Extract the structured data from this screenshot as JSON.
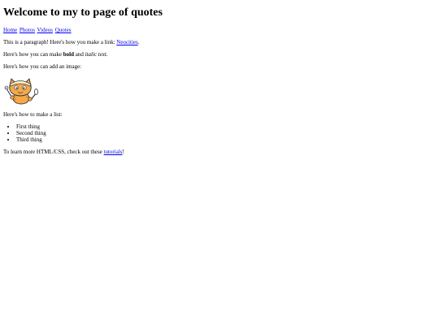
{
  "heading": "Welcome to my to page of quotes",
  "nav": {
    "home": "Home",
    "photos": "Photos",
    "videos": "Videos",
    "quotes": "Quotes"
  },
  "para1": {
    "text": "This is a paragraph! Here's how you make a link: ",
    "link": "Neocities",
    "end": "."
  },
  "para2": {
    "before": "Here's how you can make ",
    "bold": "bold",
    "middle": " and ",
    "italic": "italic text",
    "end": "."
  },
  "para3": "Here's how you can add an image:",
  "image": {
    "icon": "neocities-cat-mascot"
  },
  "para4": "Here's how to make a list:",
  "list": [
    "First thing",
    "Second thing",
    "Third thing"
  ],
  "para5": {
    "text": "To learn more HTML/CSS, check out these ",
    "link": "tutorials",
    "end": "!"
  }
}
